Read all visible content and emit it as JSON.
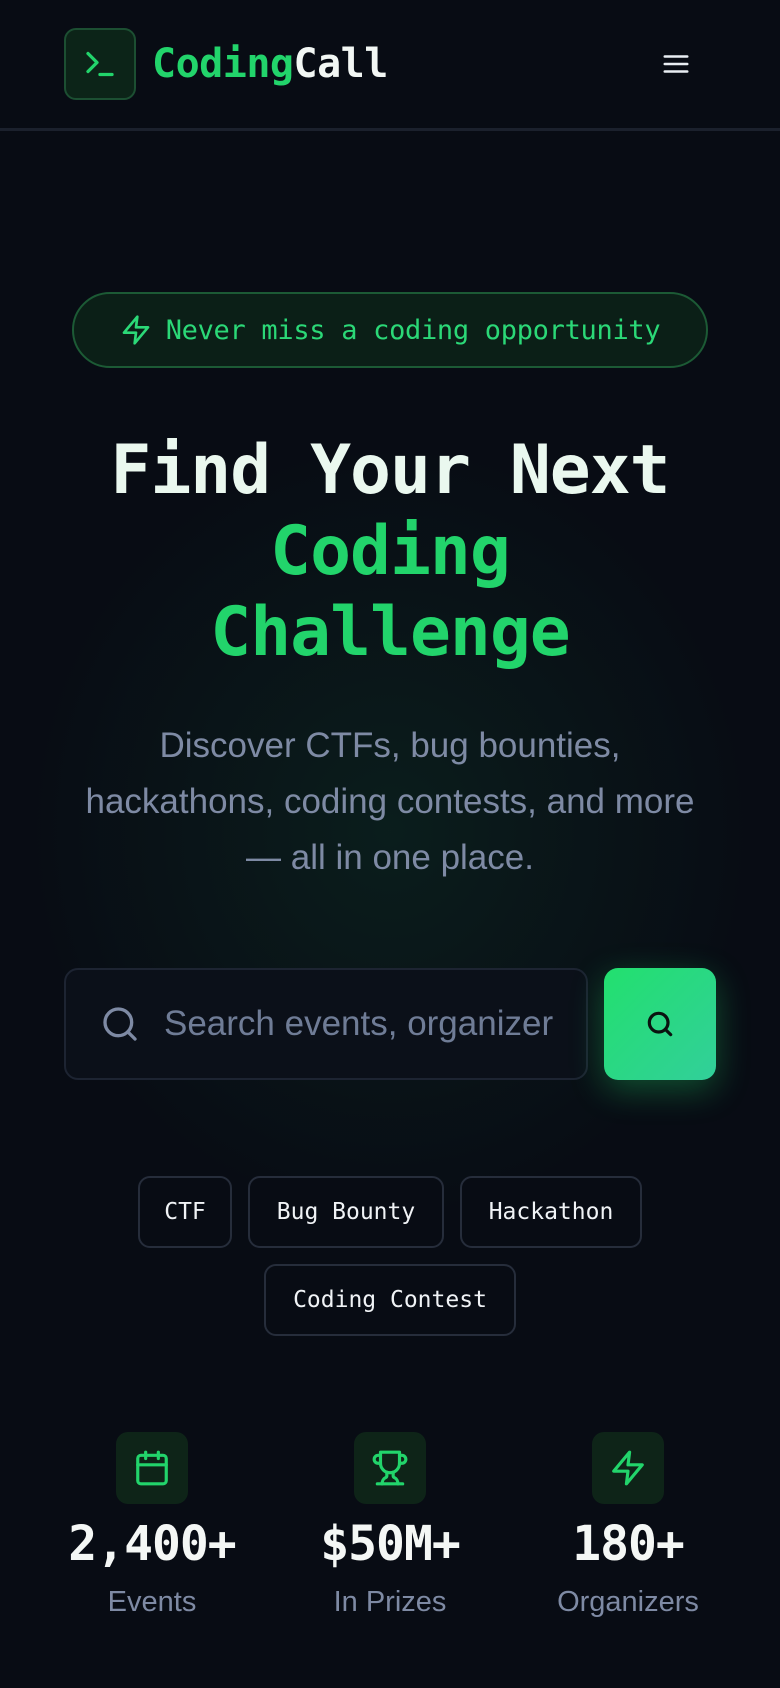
{
  "header": {
    "brand_part1": "Coding",
    "brand_part2": "Call",
    "logo_icon": "terminal-icon",
    "menu_icon": "menu-icon"
  },
  "hero": {
    "badge_text": "Never miss a coding opportunity",
    "badge_icon": "zap-icon",
    "headline_line1": "Find Your Next",
    "headline_line2": "Coding",
    "headline_line3": "Challenge",
    "subtitle": "Discover CTFs, bug bounties, hackathons, coding contests, and more — all in one place."
  },
  "search": {
    "placeholder": "Search events, organizers...",
    "value": ""
  },
  "categories": [
    {
      "label": "CTF"
    },
    {
      "label": "Bug Bounty"
    },
    {
      "label": "Hackathon"
    },
    {
      "label": "Coding Contest"
    }
  ],
  "stats": [
    {
      "value": "2,400+",
      "label": "Events",
      "icon": "calendar-icon"
    },
    {
      "value": "$50M+",
      "label": "In Prizes",
      "icon": "trophy-icon"
    },
    {
      "value": "180+",
      "label": "Organizers",
      "icon": "zap-icon"
    }
  ],
  "colors": {
    "accent": "#22d46b",
    "background": "#080c14",
    "muted_text": "#7e8aa4"
  }
}
